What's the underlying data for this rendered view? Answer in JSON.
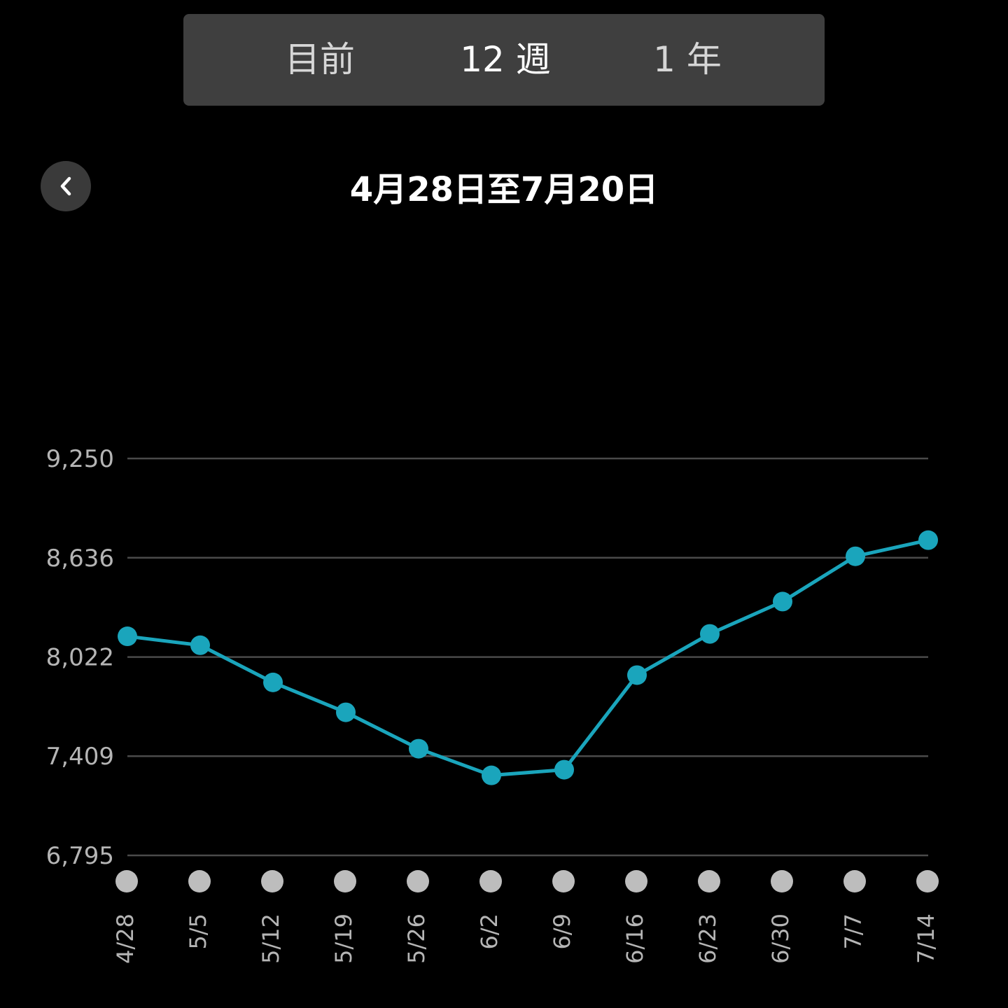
{
  "tabs": [
    {
      "label": "目前",
      "active": false
    },
    {
      "label": "12 週",
      "active": true
    },
    {
      "label": "1 年",
      "active": false
    }
  ],
  "header": {
    "back_icon": "chevron-left-icon",
    "date_range": "4月28日至7月20日"
  },
  "colors": {
    "background": "#000000",
    "line": "#1aa5bc",
    "grid": "#4a4a4a",
    "axis_text": "#b5b5b5",
    "x_marker": "#bdbdbd",
    "tab_bar": "#3f3f3f"
  },
  "chart_data": {
    "type": "line",
    "categories": [
      "4/28",
      "5/5",
      "5/12",
      "5/19",
      "5/26",
      "6/2",
      "6/9",
      "6/16",
      "6/23",
      "6/30",
      "7/7",
      "7/14"
    ],
    "values": [
      8150,
      8095,
      7865,
      7680,
      7455,
      7290,
      7325,
      7910,
      8165,
      8365,
      8645,
      8745
    ],
    "ylim": [
      6795,
      9250
    ],
    "yticks": [
      "9,250",
      "8,636",
      "8,022",
      "7,409",
      "6,795"
    ],
    "ytick_values": [
      9250,
      8636,
      8022,
      7409,
      6795
    ],
    "grid": true,
    "title": "",
    "xlabel": "",
    "ylabel": ""
  }
}
